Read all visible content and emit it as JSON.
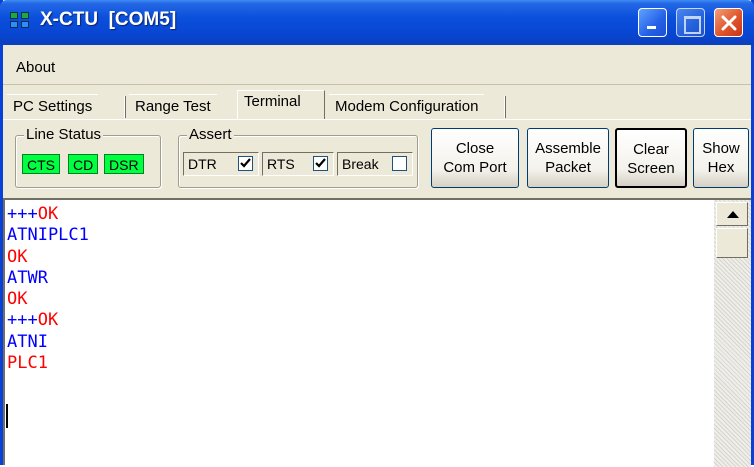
{
  "window": {
    "title": "X-CTU  [COM5]"
  },
  "menu": {
    "items": [
      "About"
    ]
  },
  "tabs": [
    "PC Settings",
    "Range Test",
    "Terminal",
    "Modem Configuration"
  ],
  "active_tab": "Terminal",
  "line_status": {
    "title": "Line Status",
    "indicators": [
      "CTS",
      "CD",
      "DSR"
    ],
    "indicator_color": "#00ff40"
  },
  "assert": {
    "title": "Assert",
    "items": [
      {
        "label": "DTR",
        "checked": true
      },
      {
        "label": "RTS",
        "checked": true
      },
      {
        "label": "Break",
        "checked": false
      }
    ]
  },
  "buttons": {
    "close_port": [
      "Close",
      "Com Port"
    ],
    "assemble_packet": [
      "Assemble",
      "Packet"
    ],
    "clear_screen": [
      "Clear",
      "Screen"
    ],
    "show_hex": [
      "Show",
      "Hex"
    ]
  },
  "terminal": {
    "lines": [
      {
        "text": "+++OK",
        "color": "#ff0000"
      },
      {
        "text": "ATNIPLC1",
        "color": "#0000ff"
      },
      {
        "text": "OK",
        "color": "#ff0000"
      },
      {
        "text": "ATWR",
        "color": "#0000ff"
      },
      {
        "text": "OK",
        "color": "#ff0000"
      },
      {
        "text": "+++OK",
        "color": "#ff0000"
      },
      {
        "text": "ATNI",
        "color": "#0000ff"
      },
      {
        "text": "PLC1",
        "color": "#ff0000"
      }
    ],
    "segments": [
      [
        "+++",
        "#0000ff"
      ],
      [
        "OK",
        "#ff0000"
      ]
    ]
  },
  "icons": {
    "app": "app-icon",
    "minimize": "minimize-icon",
    "maximize": "maximize-icon",
    "close": "close-icon",
    "scroll_up": "arrow-up-icon",
    "checkmark": "checkmark-icon"
  }
}
